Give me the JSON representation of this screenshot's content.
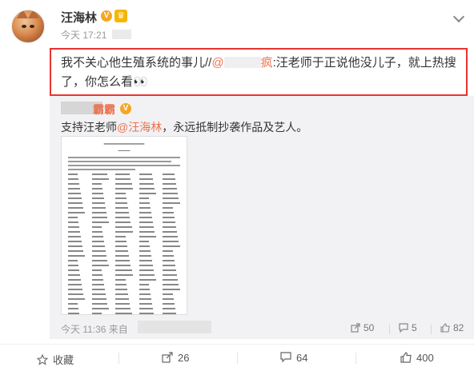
{
  "post": {
    "author": "汪海林",
    "verified_badge": "V",
    "time": "今天 17:21",
    "repost_text_prefix": "我不关心他生殖系统的事儿//",
    "repost_mention": "@",
    "repost_mention_tail": "疯",
    "repost_text_suffix": ":汪老师于正说他没儿子，就上热搜了，你怎么看",
    "eyes_emoji": "👀"
  },
  "original": {
    "author_suffix": "霸霸",
    "verified_badge": "V",
    "text_prefix": "支持汪老师",
    "mention": "@汪海林",
    "text_suffix": "，永远抵制抄袭作品及艺人。",
    "time": "今天 11:36 来自",
    "share_count": "50",
    "comment_count": "5",
    "like_count": "82"
  },
  "actions": {
    "favorite_label": "收藏",
    "forward_count": "26",
    "comment_count": "64",
    "like_count": "400"
  },
  "colors": {
    "accent": "#eb7350",
    "highlight_border": "#e8342f",
    "badge": "#f5a623"
  }
}
